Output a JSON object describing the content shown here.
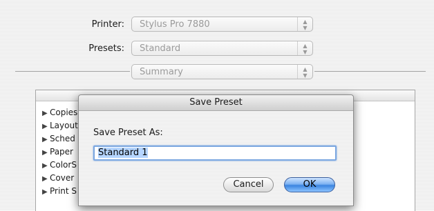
{
  "printer": {
    "label": "Printer:",
    "value": "Stylus Pro 7880"
  },
  "presets": {
    "label": "Presets:",
    "value": "Standard"
  },
  "pane_menu": {
    "value": "Summary"
  },
  "summary_items": [
    "Copies",
    "Layout",
    "Sched",
    "Paper",
    "ColorS",
    "Cover",
    "Print S"
  ],
  "dialog": {
    "title": "Save Preset",
    "prompt": "Save Preset As:",
    "input_value": "Standard 1",
    "cancel_label": "Cancel",
    "ok_label": "OK"
  },
  "glyphs": {
    "disclosure": "▶",
    "popup_arrows": "▲▼"
  }
}
